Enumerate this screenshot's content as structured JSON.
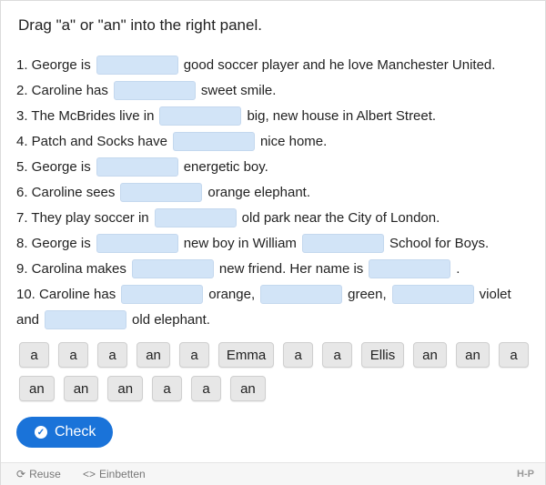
{
  "title": "Drag \"a\" or \"an\" into the right panel.",
  "sentences": {
    "s1": {
      "a": "1. George is",
      "b": "good soccer player and he love Manchester United."
    },
    "s2": {
      "a": "2. Caroline has",
      "b": "sweet smile."
    },
    "s3": {
      "a": "3. The McBrides live in",
      "b": "big, new house in Albert Street."
    },
    "s4": {
      "a": "4. Patch and Socks have",
      "b": "nice home."
    },
    "s5": {
      "a": "5. George is",
      "b": "energetic boy."
    },
    "s6": {
      "a": "6. Caroline sees",
      "b": "orange elephant."
    },
    "s7": {
      "a": "7. They play soccer in",
      "b": "old park near the City of London."
    },
    "s8": {
      "a": "8. George is",
      "b": "new boy in William",
      "c": "School for Boys."
    },
    "s9": {
      "a": "9. Carolina makes",
      "b": "new friend. Her name is",
      "c": "."
    },
    "s10": {
      "a": "10. Caroline has",
      "b": "orange,",
      "c": "green,",
      "d": "violet",
      "e": "and",
      "f": "old elephant."
    }
  },
  "words": {
    "row1": [
      "a",
      "a",
      "a",
      "an",
      "a",
      "Emma",
      "a",
      "a",
      "Ellis",
      "an",
      "an",
      "a"
    ],
    "row2": [
      "an",
      "an",
      "an",
      "a",
      "a",
      "an"
    ]
  },
  "check_button": {
    "label": "Check",
    "icon": "check-circle-icon",
    "color": "#1a73d9"
  },
  "footer": {
    "reuse": "Reuse",
    "embed": "Einbetten",
    "brand": "H-P"
  },
  "colors": {
    "drop_zone": "#d2e4f7",
    "word_bg": "#e7e7e7"
  }
}
